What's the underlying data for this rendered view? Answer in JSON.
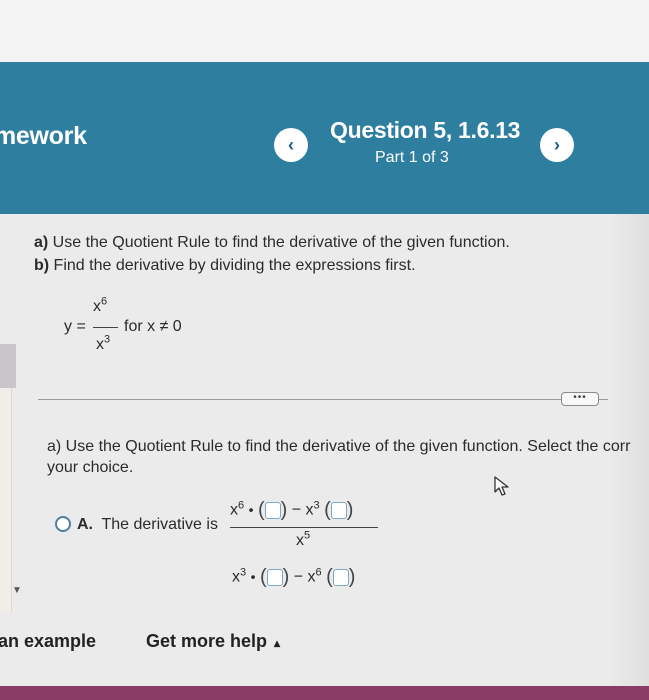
{
  "header": {
    "homework_title": "mework",
    "question_title": "Question 5, 1.6.13",
    "part_label": "Part 1 of 3",
    "prev_glyph": "‹",
    "next_glyph": "›"
  },
  "instructions": {
    "a_prefix": "a)",
    "a_text": " Use the Quotient Rule to find the derivative of the given function.",
    "b_prefix": "b)",
    "b_text": " Find the derivative by dividing the expressions first."
  },
  "function": {
    "lhs": "y =",
    "numerator_base": "x",
    "numerator_exp": "6",
    "denominator_base": "x",
    "denominator_exp": "3",
    "condition": "for x ≠ 0"
  },
  "more_button": "•••",
  "subpart": {
    "prompt_line1": "a) Use the Quotient Rule to find the derivative of the given function. Select the corr",
    "prompt_line2": "your choice."
  },
  "option_a": {
    "letter": "A.",
    "text": "The derivative is",
    "num_term1_base": "x",
    "num_term1_exp": "6",
    "num_term2_base": "x",
    "num_term2_exp": "3",
    "den_base": "x",
    "den_exp": "5",
    "row2_term1_base": "x",
    "row2_term1_exp": "3",
    "row2_term2_base": "x",
    "row2_term2_exp": "6",
    "dot": "•",
    "minus": "−"
  },
  "footer": {
    "example_link": "an example",
    "help_link": "Get more help",
    "help_caret": "▴"
  },
  "colors": {
    "header_bg": "#2e7ea0",
    "bottom_bar": "#8a3b66",
    "radio_border": "#4d7fa6"
  }
}
